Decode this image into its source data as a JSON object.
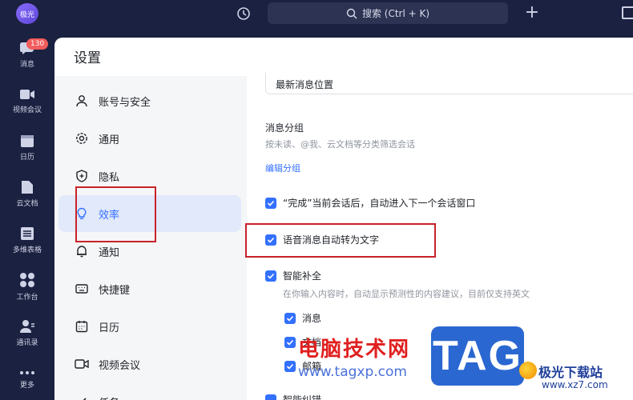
{
  "topbar": {
    "avatar_text": "极光",
    "search_text": "搜索 (Ctrl + K)"
  },
  "leftnav": {
    "badge": "130",
    "items": [
      {
        "label": "消息",
        "icon": "chat-icon"
      },
      {
        "label": "视频会议",
        "icon": "video-icon"
      },
      {
        "label": "日历",
        "icon": "calendar-icon"
      },
      {
        "label": "云文档",
        "icon": "doc-icon"
      },
      {
        "label": "多维表格",
        "icon": "table-icon"
      },
      {
        "label": "工作台",
        "icon": "grid-icon"
      },
      {
        "label": "通讯录",
        "icon": "contacts-icon"
      },
      {
        "label": "更多",
        "icon": "more-icon"
      }
    ]
  },
  "settings": {
    "title": "设置",
    "menu": [
      {
        "label": "账号与安全",
        "icon": "user-icon"
      },
      {
        "label": "通用",
        "icon": "gear-icon"
      },
      {
        "label": "隐私",
        "icon": "shield-icon"
      },
      {
        "label": "效率",
        "icon": "bulb-icon"
      },
      {
        "label": "通知",
        "icon": "bell-icon"
      },
      {
        "label": "快捷键",
        "icon": "keyboard-icon"
      },
      {
        "label": "日历",
        "icon": "calendar-icon"
      },
      {
        "label": "视频会议",
        "icon": "video-icon"
      },
      {
        "label": "任务",
        "icon": "task-icon"
      }
    ],
    "active_menu": "效率",
    "content": {
      "select_value": "最新消息位置",
      "group_title": "消息分组",
      "group_desc": "按未读、@我、云文档等分类筛选会话",
      "group_link": "编辑分组",
      "opt_done": "“完成”当前会话后，自动进入下一个会话窗口",
      "opt_voice": "语音消息自动转为文字",
      "opt_smart": "智能补全",
      "opt_smart_desc": "在你输入内容时，自动显示预测性的内容建议，目前仅支持英文",
      "sub_msg": "消息",
      "sub_doc": "文档",
      "sub_mail": "邮箱",
      "opt_more": "智能纠错"
    }
  },
  "watermark": {
    "cn": "电脑技术网",
    "url": "www.tagxp.com",
    "tag": "TAG",
    "brand": "极光下载站",
    "brand_url": "www.xz7.com"
  },
  "colors": {
    "accent": "#3370ff",
    "highlight": "#c8222a",
    "nav_bg": "#1b2140"
  }
}
